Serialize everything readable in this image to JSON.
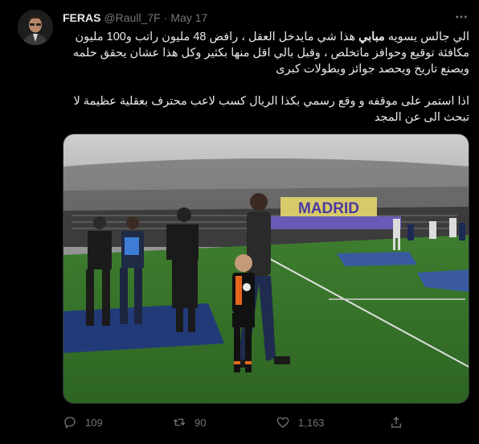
{
  "user": {
    "name": "FERAS",
    "handle": "@Raull_7F",
    "separator": "·",
    "date": "May 17"
  },
  "tweet": {
    "paragraph1_pre": "الي جالس يسويه ",
    "paragraph1_highlight": "مبابي",
    "paragraph1_post": " هذا شي مايدخل العقل ، رافض 48 مليون راتب و100 مليون مكافئة توقيع وحوافز ماتخلص ، وقبل بالي اقل منها بكثير وكل هذا عشان يحقق حلمه ويصنع تاريخ ويحصد جوائز وبطولات كبرى",
    "paragraph2": "اذا استمر على موقفه و وقع رسمي بكذا الريال كسب لاعب محترف بعقلية عظيمة لا تبحث الى عن المجد"
  },
  "media": {
    "stadium_banner": "MADRID"
  },
  "actions": {
    "replies": "109",
    "retweets": "90",
    "likes": "1,163"
  },
  "icons": [
    "more-icon",
    "reply-icon",
    "retweet-icon",
    "like-icon",
    "share-icon"
  ],
  "colors": {
    "background": "#000000",
    "text": "#e7e9ea",
    "muted": "#71767b",
    "border": "#2f3336"
  }
}
